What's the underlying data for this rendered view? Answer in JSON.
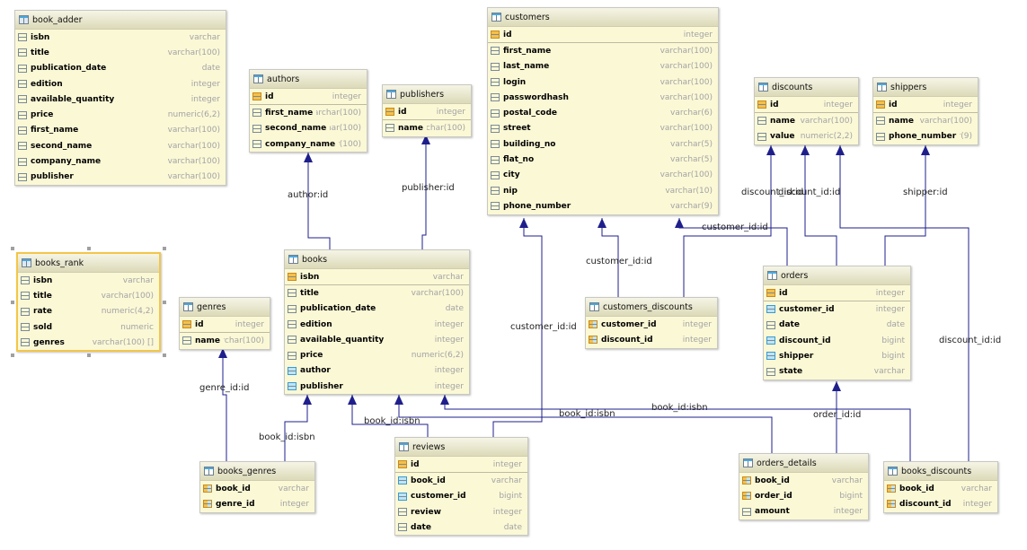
{
  "colors": {
    "edge": "#1f1f8c",
    "table_bg": "#fbf8d6",
    "selected_border": "#f3c64a"
  },
  "tables": [
    {
      "name": "book_adder",
      "kind": "view",
      "columns": [
        {
          "name": "isbn",
          "type": "varchar",
          "icon": "column"
        },
        {
          "name": "title",
          "type": "varchar(100)",
          "icon": "column"
        },
        {
          "name": "publication_date",
          "type": "date",
          "icon": "column"
        },
        {
          "name": "edition",
          "type": "integer",
          "icon": "column"
        },
        {
          "name": "available_quantity",
          "type": "integer",
          "icon": "column"
        },
        {
          "name": "price",
          "type": "numeric(6,2)",
          "icon": "column"
        },
        {
          "name": "first_name",
          "type": "varchar(100)",
          "icon": "column"
        },
        {
          "name": "second_name",
          "type": "varchar(100)",
          "icon": "column"
        },
        {
          "name": "company_name",
          "type": "varchar(100)",
          "icon": "column"
        },
        {
          "name": "publisher",
          "type": "varchar(100)",
          "icon": "column"
        }
      ]
    },
    {
      "name": "authors",
      "kind": "table",
      "columns": [
        {
          "name": "id",
          "type": "integer",
          "icon": "primary-key"
        },
        {
          "name": "first_name",
          "type": "varchar(100)",
          "icon": "column"
        },
        {
          "name": "second_name",
          "type": "varchar(100)",
          "icon": "column"
        },
        {
          "name": "company_name",
          "type": "varchar(100)",
          "icon": "column"
        }
      ]
    },
    {
      "name": "publishers",
      "kind": "table",
      "columns": [
        {
          "name": "id",
          "type": "integer",
          "icon": "primary-key"
        },
        {
          "name": "name",
          "type": "varchar(100)",
          "icon": "column"
        }
      ]
    },
    {
      "name": "customers",
      "kind": "table",
      "columns": [
        {
          "name": "id",
          "type": "integer",
          "icon": "primary-key"
        },
        {
          "name": "first_name",
          "type": "varchar(100)",
          "icon": "column"
        },
        {
          "name": "last_name",
          "type": "varchar(100)",
          "icon": "column"
        },
        {
          "name": "login",
          "type": "varchar(100)",
          "icon": "column"
        },
        {
          "name": "passwordhash",
          "type": "varchar(100)",
          "icon": "column"
        },
        {
          "name": "postal_code",
          "type": "varchar(6)",
          "icon": "column"
        },
        {
          "name": "street",
          "type": "varchar(100)",
          "icon": "column"
        },
        {
          "name": "building_no",
          "type": "varchar(5)",
          "icon": "column"
        },
        {
          "name": "flat_no",
          "type": "varchar(5)",
          "icon": "column"
        },
        {
          "name": "city",
          "type": "varchar(100)",
          "icon": "column"
        },
        {
          "name": "nip",
          "type": "varchar(10)",
          "icon": "column"
        },
        {
          "name": "phone_number",
          "type": "varchar(9)",
          "icon": "column"
        }
      ]
    },
    {
      "name": "discounts",
      "kind": "table",
      "columns": [
        {
          "name": "id",
          "type": "integer",
          "icon": "primary-key"
        },
        {
          "name": "name",
          "type": "varchar(100)",
          "icon": "column"
        },
        {
          "name": "value",
          "type": "numeric(2,2)",
          "icon": "column"
        }
      ]
    },
    {
      "name": "shippers",
      "kind": "table",
      "columns": [
        {
          "name": "id",
          "type": "integer",
          "icon": "primary-key"
        },
        {
          "name": "name",
          "type": "varchar(100)",
          "icon": "column"
        },
        {
          "name": "phone_number",
          "type": "varchar(9)",
          "icon": "column"
        }
      ]
    },
    {
      "name": "books_rank",
      "kind": "view",
      "selected": true,
      "columns": [
        {
          "name": "isbn",
          "type": "varchar",
          "icon": "column"
        },
        {
          "name": "title",
          "type": "varchar(100)",
          "icon": "column"
        },
        {
          "name": "rate",
          "type": "numeric(4,2)",
          "icon": "column"
        },
        {
          "name": "sold",
          "type": "numeric",
          "icon": "column"
        },
        {
          "name": "genres",
          "type": "varchar(100) []",
          "icon": "column"
        }
      ]
    },
    {
      "name": "genres",
      "kind": "table",
      "columns": [
        {
          "name": "id",
          "type": "integer",
          "icon": "primary-key"
        },
        {
          "name": "name",
          "type": "varchar(100)",
          "icon": "column"
        }
      ]
    },
    {
      "name": "books",
      "kind": "table",
      "columns": [
        {
          "name": "isbn",
          "type": "varchar",
          "icon": "primary-key"
        },
        {
          "name": "title",
          "type": "varchar(100)",
          "icon": "column"
        },
        {
          "name": "publication_date",
          "type": "date",
          "icon": "column"
        },
        {
          "name": "edition",
          "type": "integer",
          "icon": "column"
        },
        {
          "name": "available_quantity",
          "type": "integer",
          "icon": "column"
        },
        {
          "name": "price",
          "type": "numeric(6,2)",
          "icon": "column"
        },
        {
          "name": "author",
          "type": "integer",
          "icon": "foreign-key"
        },
        {
          "name": "publisher",
          "type": "integer",
          "icon": "foreign-key"
        }
      ]
    },
    {
      "name": "customers_discounts",
      "kind": "table",
      "columns": [
        {
          "name": "customer_id",
          "type": "integer",
          "icon": "primary-foreign-key"
        },
        {
          "name": "discount_id",
          "type": "integer",
          "icon": "primary-foreign-key"
        }
      ]
    },
    {
      "name": "orders",
      "kind": "table",
      "columns": [
        {
          "name": "id",
          "type": "integer",
          "icon": "primary-key"
        },
        {
          "name": "customer_id",
          "type": "integer",
          "icon": "foreign-key"
        },
        {
          "name": "date",
          "type": "date",
          "icon": "column"
        },
        {
          "name": "discount_id",
          "type": "bigint",
          "icon": "foreign-key"
        },
        {
          "name": "shipper",
          "type": "bigint",
          "icon": "foreign-key"
        },
        {
          "name": "state",
          "type": "varchar",
          "icon": "column"
        }
      ]
    },
    {
      "name": "reviews",
      "kind": "table",
      "columns": [
        {
          "name": "id",
          "type": "integer",
          "icon": "primary-key"
        },
        {
          "name": "book_id",
          "type": "varchar",
          "icon": "foreign-key"
        },
        {
          "name": "customer_id",
          "type": "bigint",
          "icon": "foreign-key"
        },
        {
          "name": "review",
          "type": "integer",
          "icon": "column"
        },
        {
          "name": "date",
          "type": "date",
          "icon": "column"
        }
      ]
    },
    {
      "name": "books_genres",
      "kind": "table",
      "columns": [
        {
          "name": "book_id",
          "type": "varchar",
          "icon": "primary-foreign-key"
        },
        {
          "name": "genre_id",
          "type": "integer",
          "icon": "primary-foreign-key"
        }
      ]
    },
    {
      "name": "orders_details",
      "kind": "table",
      "columns": [
        {
          "name": "book_id",
          "type": "varchar",
          "icon": "primary-foreign-key"
        },
        {
          "name": "order_id",
          "type": "bigint",
          "icon": "primary-foreign-key"
        },
        {
          "name": "amount",
          "type": "integer",
          "icon": "column"
        }
      ]
    },
    {
      "name": "books_discounts",
      "kind": "table",
      "columns": [
        {
          "name": "book_id",
          "type": "varchar",
          "icon": "primary-foreign-key"
        },
        {
          "name": "discount_id",
          "type": "integer",
          "icon": "primary-foreign-key"
        }
      ]
    }
  ],
  "relationships": [
    {
      "from": "books",
      "to": "authors",
      "label": "author:id"
    },
    {
      "from": "books",
      "to": "publishers",
      "label": "publisher:id"
    },
    {
      "from": "books_genres",
      "to": "genres",
      "label": "genre_id:id"
    },
    {
      "from": "books_genres",
      "to": "books",
      "label": "book_id:isbn"
    },
    {
      "from": "reviews",
      "to": "books",
      "label": "book_id:isbn"
    },
    {
      "from": "orders_details",
      "to": "books",
      "label": "book_id:isbn"
    },
    {
      "from": "books_discounts",
      "to": "books",
      "label": "book_id:isbn"
    },
    {
      "from": "reviews",
      "to": "customers",
      "label": "customer_id:id"
    },
    {
      "from": "customers_discounts",
      "to": "customers",
      "label": "customer_id:id"
    },
    {
      "from": "orders",
      "to": "customers",
      "label": "customer_id:id"
    },
    {
      "from": "customers_discounts",
      "to": "discounts",
      "label": "discount_id:id"
    },
    {
      "from": "orders",
      "to": "discounts",
      "label": "discount_id:id"
    },
    {
      "from": "books_discounts",
      "to": "discounts",
      "label": "discount_id:id"
    },
    {
      "from": "orders",
      "to": "shippers",
      "label": "shipper:id"
    },
    {
      "from": "orders_details",
      "to": "orders",
      "label": "order_id:id"
    }
  ]
}
